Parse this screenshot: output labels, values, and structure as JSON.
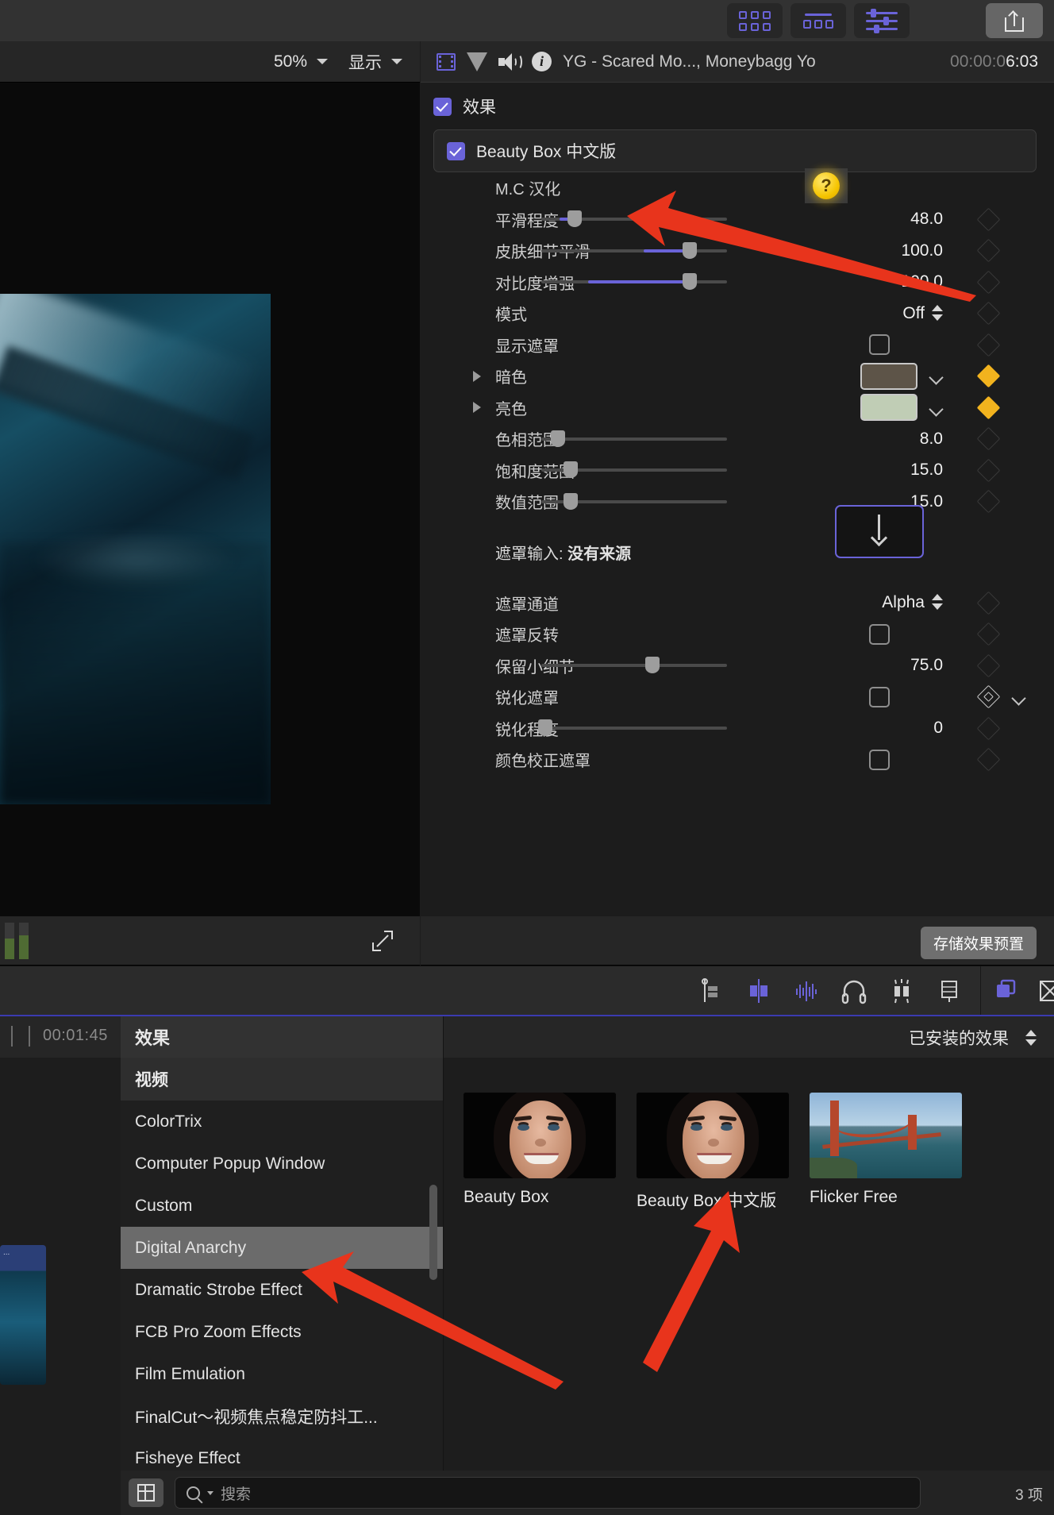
{
  "toolbar": {
    "browser_button": "grid-view",
    "timeline_button": "list-view",
    "inspector_button": "sliders-view",
    "share_button": "share"
  },
  "viewer": {
    "zoom_level": "50%",
    "display_menu": "显示"
  },
  "inspector": {
    "clip_title": "YG - Scared Mo..., Moneybagg Yo",
    "timecode_dim": "00:00:0",
    "timecode_lit": "6:03",
    "effects_section": "效果",
    "effect_name": "Beauty Box 中文版",
    "save_preset": "存储效果预置",
    "params": [
      {
        "label": "M.C 汉化",
        "type": "help",
        "value": ""
      },
      {
        "label": "平滑程度",
        "type": "slider",
        "value": "48.0",
        "pos": 18,
        "fill_from": 10,
        "fill_to": 18
      },
      {
        "label": "皮肤细节平滑",
        "type": "slider",
        "value": "100.0",
        "pos": 80,
        "fill_from": 55,
        "fill_to": 80
      },
      {
        "label": "对比度增强",
        "type": "slider",
        "value": "100.0",
        "pos": 80,
        "fill_from": 25,
        "fill_to": 80
      },
      {
        "label": "模式",
        "type": "popup",
        "value": "Off"
      },
      {
        "label": "显示遮罩",
        "type": "checkbox",
        "value": ""
      },
      {
        "label": "暗色",
        "type": "color",
        "value": "#5d5448",
        "keyed": true,
        "disclosure": true
      },
      {
        "label": "亮色",
        "type": "color",
        "value": "#c0cdb5",
        "keyed": true,
        "disclosure": true
      },
      {
        "label": "色相范围",
        "type": "slider",
        "value": "8.0",
        "pos": 9,
        "fill_from": 0,
        "fill_to": 0
      },
      {
        "label": "饱和度范围",
        "type": "slider",
        "value": "15.0",
        "pos": 16,
        "fill_from": 0,
        "fill_to": 0
      },
      {
        "label": "数值范围",
        "type": "slider",
        "value": "15.0",
        "pos": 16,
        "fill_from": 0,
        "fill_to": 0
      },
      {
        "label": "遮罩输入:",
        "label_bold": "没有来源",
        "type": "dropwell",
        "value": ""
      },
      {
        "label": "遮罩通道",
        "type": "popup",
        "value": "Alpha"
      },
      {
        "label": "遮罩反转",
        "type": "checkbox",
        "value": ""
      },
      {
        "label": "保留小细节",
        "type": "slider",
        "value": "75.0",
        "pos": 60,
        "fill_from": 0,
        "fill_to": 0
      },
      {
        "label": "锐化遮罩",
        "type": "checkbox",
        "value": "",
        "keyframe_mid": true
      },
      {
        "label": "锐化程度",
        "type": "slider",
        "value": "0",
        "pos": 2,
        "fill_from": 0,
        "fill_to": 0
      },
      {
        "label": "颜色校正遮罩",
        "type": "checkbox",
        "value": ""
      }
    ]
  },
  "timeline_toolbar": {
    "icons": [
      "trim-tool-icon",
      "transition-icon",
      "audio-waveform-icon",
      "headphone-icon",
      "solo-icon",
      "filmstrip-icon",
      "index-icon",
      "close-panel-icon"
    ]
  },
  "timeline": {
    "playhead_timecode": "00:01:45",
    "clip_label": "..."
  },
  "browser": {
    "panel_title": "效果",
    "installed_label": "已安装的效果",
    "group_heading": "视频",
    "categories": [
      "ColorTrix",
      "Computer Popup Window",
      "Custom",
      "Digital Anarchy",
      "Dramatic Strobe Effect",
      "FCB Pro Zoom Effects",
      "Film Emulation",
      "FinalCut～视频焦点稳定防抖工...",
      "Fisheye Effect"
    ],
    "selected_category": "Digital Anarchy",
    "items": [
      {
        "name": "Beauty Box",
        "thumb": "face"
      },
      {
        "name": "Beauty Box 中文版",
        "thumb": "face"
      },
      {
        "name": "Flicker Free",
        "thumb": "bridge"
      }
    ],
    "search_placeholder": "搜索",
    "item_count": "3 项"
  },
  "annotations": {
    "arrow_color": "#e8341c",
    "arrow_1_target": "M.C 汉化",
    "arrow_2_target": "Digital Anarchy",
    "arrow_3_target": "Beauty Box 中文版"
  }
}
